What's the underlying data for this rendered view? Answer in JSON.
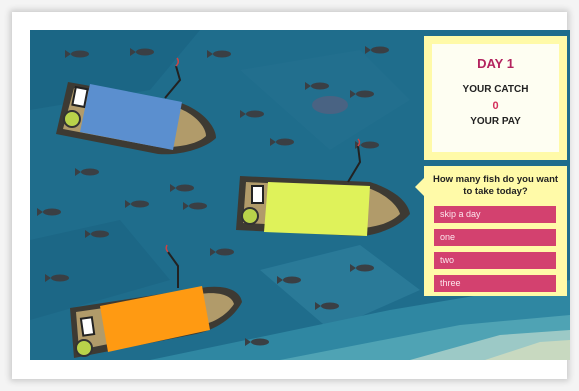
{
  "status_panel": {
    "day": "DAY 1",
    "catch_label": "YOUR CATCH",
    "catch_value": "0",
    "pay_label": "YOUR PAY"
  },
  "question_panel": {
    "question": "How many fish do you want to take today?",
    "options": [
      "skip a day",
      "one",
      "two",
      "three"
    ]
  },
  "boats": [
    {
      "color": "blue",
      "cabin_color": "#5b8fcf"
    },
    {
      "color": "yellow",
      "cabin_color": "#dff25a"
    },
    {
      "color": "orange",
      "cabin_color": "#ff9a12"
    }
  ],
  "colors": {
    "water": "#1f6d8c",
    "panel_bg": "#fffaa8",
    "button": "#d3416f",
    "day_title": "#b3245f"
  }
}
